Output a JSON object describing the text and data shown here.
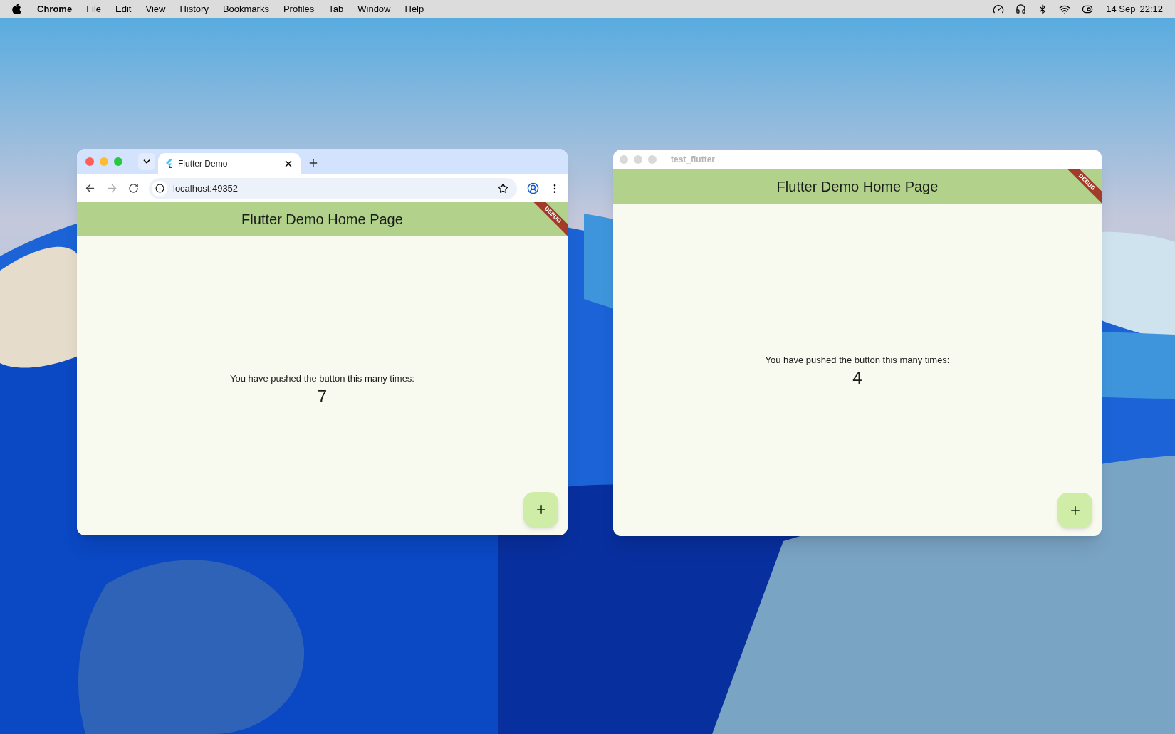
{
  "menu_bar": {
    "app": "Chrome",
    "items": [
      "File",
      "Edit",
      "View",
      "History",
      "Bookmarks",
      "Profiles",
      "Tab",
      "Window",
      "Help"
    ],
    "date": "14 Sep",
    "time": "22:12"
  },
  "browser_window": {
    "focused": true,
    "tab": {
      "title": "Flutter Demo",
      "selected": true
    },
    "can_go_forward": false,
    "address": "localhost:49352",
    "app": {
      "title": "Flutter Demo Home Page",
      "banner": "DEBUG",
      "message": "You have pushed the button this many times:",
      "counter": "7"
    }
  },
  "app_window": {
    "focused": false,
    "title": "test_flutter",
    "app": {
      "title": "Flutter Demo Home Page",
      "banner": "DEBUG",
      "message": "You have pushed the button this many times:",
      "counter": "4"
    }
  }
}
